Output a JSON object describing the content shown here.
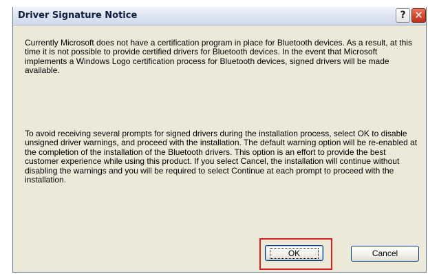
{
  "dialog": {
    "title": "Driver Signature Notice",
    "help_label": "?",
    "close_label": "✕",
    "paragraph1": "Currently Microsoft does not have a certification program in place for Bluetooth devices. As a result, at this time it is not possible to provide certified drivers for Bluetooth devices.  In the event that Microsoft implements a Windows Logo certification process for Bluetooth devices, signed drivers will be made available.",
    "paragraph2": "To avoid receiving several prompts for signed drivers during the installation process, select OK to disable unsigned driver warnings, and proceed with the installation. The default warning option will be re-enabled at the completion of the installation of the Bluetooth drivers. This option is an effort to provide the best customer experience while using this product. If you select Cancel, the installation will continue without disabling the warnings and you will be required to select Continue at each prompt to proceed with the installation.",
    "buttons": {
      "ok_label": "OK",
      "cancel_label": "Cancel"
    }
  },
  "colors": {
    "dialog_background": "#ece9d8",
    "close_button": "#d0482f",
    "highlight_border": "#e02020"
  },
  "icons": {
    "help": "help-icon",
    "close": "close-icon"
  }
}
